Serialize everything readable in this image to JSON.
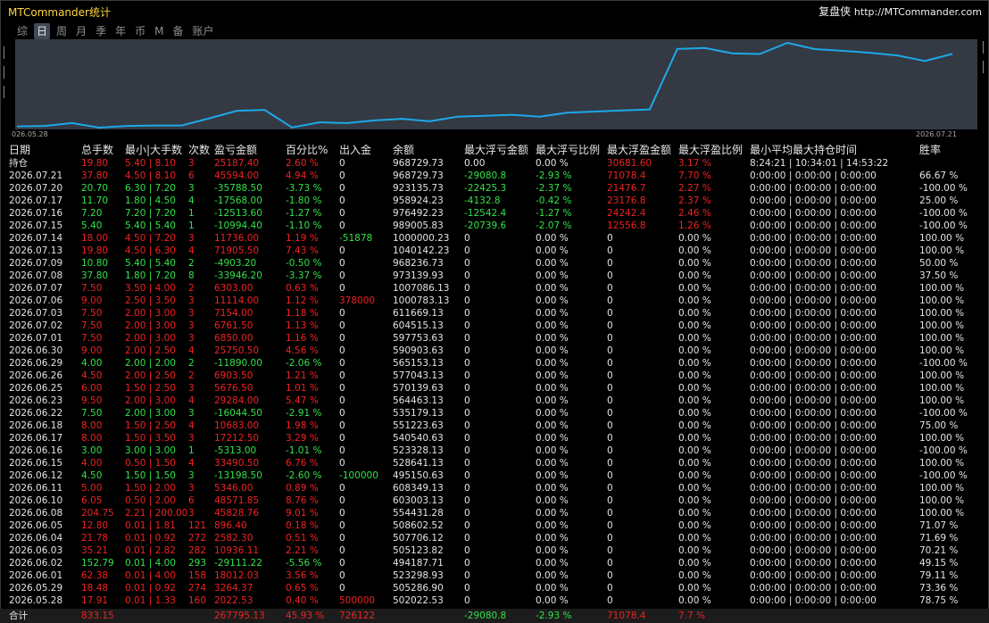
{
  "app_title": "MTCommander统计",
  "brand_name": "复盘侠",
  "brand_url": "http://MTCommander.com",
  "tabs": [
    "综",
    "日",
    "周",
    "月",
    "季",
    "年",
    "币",
    "M",
    "备",
    "账户"
  ],
  "active_tab": 1,
  "chart_data": {
    "type": "line",
    "x_start": "026.05.28",
    "x_end": "2026.07.21",
    "series_color": "#1ea8e8",
    "categories": [
      "2026.05.28",
      "2026.05.29",
      "2026.06.01",
      "2026.06.02",
      "2026.06.03",
      "2026.06.04",
      "2026.06.05",
      "2026.06.08",
      "2026.06.10",
      "2026.06.11",
      "2026.06.12",
      "2026.06.15",
      "2026.06.16",
      "2026.06.17",
      "2026.06.18",
      "2026.06.22",
      "2026.06.23",
      "2026.06.25",
      "2026.06.26",
      "2026.06.29",
      "2026.06.30",
      "2026.07.01",
      "2026.07.02",
      "2026.07.03",
      "2026.07.06",
      "2026.07.07",
      "2026.07.08",
      "2026.07.09",
      "2026.07.13",
      "2026.07.14",
      "2026.07.15",
      "2026.07.16",
      "2026.07.17",
      "2026.07.20",
      "2026.07.21"
    ],
    "values": [
      502022.53,
      505286.9,
      523298.93,
      494187.71,
      505123.82,
      507706.12,
      508602.52,
      554431.28,
      603003.13,
      608349.13,
      495150.63,
      528641.13,
      523328.13,
      540540.63,
      551223.63,
      535179.13,
      564463.13,
      570139.63,
      577043.13,
      565153.13,
      590903.63,
      597753.63,
      604515.13,
      611669.13,
      1000783.13,
      1007086.13,
      973139.93,
      968236.73,
      1040142.23,
      1000000.23,
      989005.83,
      976492.23,
      958924.23,
      923135.73,
      968729.73
    ]
  },
  "headers": [
    "日期",
    "总手数",
    "最小|大手数",
    "次数",
    "盈亏金额",
    "百分比%",
    "出入金",
    "余额",
    "最大浮亏金额",
    "最大浮亏比例",
    "最大浮盈金额",
    "最大浮盈比例",
    "最小平均最大持仓时间",
    "胜率"
  ],
  "position_row": {
    "label": "持仓",
    "lots": "19.80",
    "minmax": "5.40 | 8.10",
    "count": "3",
    "pl": "25187.40",
    "pct": "2.60 %",
    "flow": "0",
    "bal": "968729.73",
    "mfl": "0.00",
    "mflp": "0.00 %",
    "mfp": "30681.60",
    "mfpp": "3.17 %",
    "time": "8:24:21 | 10:34:01 | 14:53:22",
    "win": ""
  },
  "rows": [
    {
      "date": "2026.07.21",
      "lots": "37.80",
      "minmax": "4.50 | 8.10",
      "count": "6",
      "pl": "45594.00",
      "pct": "4.94 %",
      "flow": "0",
      "bal": "968729.73",
      "mfl": "-29080.8",
      "mflp": "-2.93 %",
      "mfp": "71078.4",
      "mfpp": "7.70 %",
      "time": "0:00:00 | 0:00:00 | 0:00:00",
      "win": "66.67 %",
      "c": "r"
    },
    {
      "date": "2026.07.20",
      "lots": "20.70",
      "minmax": "6.30 | 7.20",
      "count": "3",
      "pl": "-35788.50",
      "pct": "-3.73 %",
      "flow": "0",
      "bal": "923135.73",
      "mfl": "-22425.3",
      "mflp": "-2.37 %",
      "mfp": "21476.7",
      "mfpp": "2.27 %",
      "time": "0:00:00 | 0:00:00 | 0:00:00",
      "win": "-100.00 %",
      "c": "g"
    },
    {
      "date": "2026.07.17",
      "lots": "11.70",
      "minmax": "1.80 | 4.50",
      "count": "4",
      "pl": "-17568.00",
      "pct": "-1.80 %",
      "flow": "0",
      "bal": "958924.23",
      "mfl": "-4132.8",
      "mflp": "-0.42 %",
      "mfp": "23176.8",
      "mfpp": "2.37 %",
      "time": "0:00:00 | 0:00:00 | 0:00:00",
      "win": "25.00 %",
      "c": "g"
    },
    {
      "date": "2026.07.16",
      "lots": "7.20",
      "minmax": "7.20 | 7.20",
      "count": "1",
      "pl": "-12513.60",
      "pct": "-1.27 %",
      "flow": "0",
      "bal": "976492.23",
      "mfl": "-12542.4",
      "mflp": "-1.27 %",
      "mfp": "24242.4",
      "mfpp": "2.46 %",
      "time": "0:00:00 | 0:00:00 | 0:00:00",
      "win": "-100.00 %",
      "c": "g"
    },
    {
      "date": "2026.07.15",
      "lots": "5.40",
      "minmax": "5.40 | 5.40",
      "count": "1",
      "pl": "-10994.40",
      "pct": "-1.10 %",
      "flow": "0",
      "bal": "989005.83",
      "mfl": "-20739.6",
      "mflp": "-2.07 %",
      "mfp": "12556.8",
      "mfpp": "1.26 %",
      "time": "0:00:00 | 0:00:00 | 0:00:00",
      "win": "-100.00 %",
      "c": "g"
    },
    {
      "date": "2026.07.14",
      "lots": "18.00",
      "minmax": "4.50 | 7.20",
      "count": "3",
      "pl": "11736.00",
      "pct": "1.19 %",
      "flow": "-51878",
      "bal": "1000000.23",
      "mfl": "0",
      "mflp": "0.00 %",
      "mfp": "0",
      "mfpp": "0.00 %",
      "time": "0:00:00 | 0:00:00 | 0:00:00",
      "win": "100.00 %",
      "c": "r"
    },
    {
      "date": "2026.07.13",
      "lots": "19.80",
      "minmax": "4.50 | 6.30",
      "count": "4",
      "pl": "71905.50",
      "pct": "7.43 %",
      "flow": "0",
      "bal": "1040142.23",
      "mfl": "0",
      "mflp": "0.00 %",
      "mfp": "0",
      "mfpp": "0.00 %",
      "time": "0:00:00 | 0:00:00 | 0:00:00",
      "win": "100.00 %",
      "c": "r"
    },
    {
      "date": "2026.07.09",
      "lots": "10.80",
      "minmax": "5.40 | 5.40",
      "count": "2",
      "pl": "-4903.20",
      "pct": "-0.50 %",
      "flow": "0",
      "bal": "968236.73",
      "mfl": "0",
      "mflp": "0.00 %",
      "mfp": "0",
      "mfpp": "0.00 %",
      "time": "0:00:00 | 0:00:00 | 0:00:00",
      "win": "50.00 %",
      "c": "g"
    },
    {
      "date": "2026.07.08",
      "lots": "37.80",
      "minmax": "1.80 | 7.20",
      "count": "8",
      "pl": "-33946.20",
      "pct": "-3.37 %",
      "flow": "0",
      "bal": "973139.93",
      "mfl": "0",
      "mflp": "0.00 %",
      "mfp": "0",
      "mfpp": "0.00 %",
      "time": "0:00:00 | 0:00:00 | 0:00:00",
      "win": "37.50 %",
      "c": "g"
    },
    {
      "date": "2026.07.07",
      "lots": "7.50",
      "minmax": "3.50 | 4.00",
      "count": "2",
      "pl": "6303.00",
      "pct": "0.63 %",
      "flow": "0",
      "bal": "1007086.13",
      "mfl": "0",
      "mflp": "0.00 %",
      "mfp": "0",
      "mfpp": "0.00 %",
      "time": "0:00:00 | 0:00:00 | 0:00:00",
      "win": "100.00 %",
      "c": "r"
    },
    {
      "date": "2026.07.06",
      "lots": "9.00",
      "minmax": "2.50 | 3.50",
      "count": "3",
      "pl": "11114.00",
      "pct": "1.12 %",
      "flow": "378000",
      "bal": "1000783.13",
      "mfl": "0",
      "mflp": "0.00 %",
      "mfp": "0",
      "mfpp": "0.00 %",
      "time": "0:00:00 | 0:00:00 | 0:00:00",
      "win": "100.00 %",
      "c": "r"
    },
    {
      "date": "2026.07.03",
      "lots": "7.50",
      "minmax": "2.00 | 3.00",
      "count": "3",
      "pl": "7154.00",
      "pct": "1.18 %",
      "flow": "0",
      "bal": "611669.13",
      "mfl": "0",
      "mflp": "0.00 %",
      "mfp": "0",
      "mfpp": "0.00 %",
      "time": "0:00:00 | 0:00:00 | 0:00:00",
      "win": "100.00 %",
      "c": "r"
    },
    {
      "date": "2026.07.02",
      "lots": "7.50",
      "minmax": "2.00 | 3.00",
      "count": "3",
      "pl": "6761.50",
      "pct": "1.13 %",
      "flow": "0",
      "bal": "604515.13",
      "mfl": "0",
      "mflp": "0.00 %",
      "mfp": "0",
      "mfpp": "0.00 %",
      "time": "0:00:00 | 0:00:00 | 0:00:00",
      "win": "100.00 %",
      "c": "r"
    },
    {
      "date": "2026.07.01",
      "lots": "7.50",
      "minmax": "2.00 | 3.00",
      "count": "3",
      "pl": "6850.00",
      "pct": "1.16 %",
      "flow": "0",
      "bal": "597753.63",
      "mfl": "0",
      "mflp": "0.00 %",
      "mfp": "0",
      "mfpp": "0.00 %",
      "time": "0:00:00 | 0:00:00 | 0:00:00",
      "win": "100.00 %",
      "c": "r"
    },
    {
      "date": "2026.06.30",
      "lots": "9.00",
      "minmax": "2.00 | 2.50",
      "count": "4",
      "pl": "25750.50",
      "pct": "4.56 %",
      "flow": "0",
      "bal": "590903.63",
      "mfl": "0",
      "mflp": "0.00 %",
      "mfp": "0",
      "mfpp": "0.00 %",
      "time": "0:00:00 | 0:00:00 | 0:00:00",
      "win": "100.00 %",
      "c": "r"
    },
    {
      "date": "2026.06.29",
      "lots": "4.00",
      "minmax": "2.00 | 2.00",
      "count": "2",
      "pl": "-11890.00",
      "pct": "-2.06 %",
      "flow": "0",
      "bal": "565153.13",
      "mfl": "0",
      "mflp": "0.00 %",
      "mfp": "0",
      "mfpp": "0.00 %",
      "time": "0:00:00 | 0:00:00 | 0:00:00",
      "win": "-100.00 %",
      "c": "g"
    },
    {
      "date": "2026.06.26",
      "lots": "4.50",
      "minmax": "2.00 | 2.50",
      "count": "2",
      "pl": "6903.50",
      "pct": "1.21 %",
      "flow": "0",
      "bal": "577043.13",
      "mfl": "0",
      "mflp": "0.00 %",
      "mfp": "0",
      "mfpp": "0.00 %",
      "time": "0:00:00 | 0:00:00 | 0:00:00",
      "win": "100.00 %",
      "c": "r"
    },
    {
      "date": "2026.06.25",
      "lots": "6.00",
      "minmax": "1.50 | 2.50",
      "count": "3",
      "pl": "5676.50",
      "pct": "1.01 %",
      "flow": "0",
      "bal": "570139.63",
      "mfl": "0",
      "mflp": "0.00 %",
      "mfp": "0",
      "mfpp": "0.00 %",
      "time": "0:00:00 | 0:00:00 | 0:00:00",
      "win": "100.00 %",
      "c": "r"
    },
    {
      "date": "2026.06.23",
      "lots": "9.50",
      "minmax": "2.00 | 3.00",
      "count": "4",
      "pl": "29284.00",
      "pct": "5.47 %",
      "flow": "0",
      "bal": "564463.13",
      "mfl": "0",
      "mflp": "0.00 %",
      "mfp": "0",
      "mfpp": "0.00 %",
      "time": "0:00:00 | 0:00:00 | 0:00:00",
      "win": "100.00 %",
      "c": "r"
    },
    {
      "date": "2026.06.22",
      "lots": "7.50",
      "minmax": "2.00 | 3.00",
      "count": "3",
      "pl": "-16044.50",
      "pct": "-2.91 %",
      "flow": "0",
      "bal": "535179.13",
      "mfl": "0",
      "mflp": "0.00 %",
      "mfp": "0",
      "mfpp": "0.00 %",
      "time": "0:00:00 | 0:00:00 | 0:00:00",
      "win": "-100.00 %",
      "c": "g"
    },
    {
      "date": "2026.06.18",
      "lots": "8.00",
      "minmax": "1.50 | 2.50",
      "count": "4",
      "pl": "10683.00",
      "pct": "1.98 %",
      "flow": "0",
      "bal": "551223.63",
      "mfl": "0",
      "mflp": "0.00 %",
      "mfp": "0",
      "mfpp": "0.00 %",
      "time": "0:00:00 | 0:00:00 | 0:00:00",
      "win": "75.00 %",
      "c": "r"
    },
    {
      "date": "2026.06.17",
      "lots": "8.00",
      "minmax": "1.50 | 3.50",
      "count": "3",
      "pl": "17212.50",
      "pct": "3.29 %",
      "flow": "0",
      "bal": "540540.63",
      "mfl": "0",
      "mflp": "0.00 %",
      "mfp": "0",
      "mfpp": "0.00 %",
      "time": "0:00:00 | 0:00:00 | 0:00:00",
      "win": "100.00 %",
      "c": "r"
    },
    {
      "date": "2026.06.16",
      "lots": "3.00",
      "minmax": "3.00 | 3.00",
      "count": "1",
      "pl": "-5313.00",
      "pct": "-1.01 %",
      "flow": "0",
      "bal": "523328.13",
      "mfl": "0",
      "mflp": "0.00 %",
      "mfp": "0",
      "mfpp": "0.00 %",
      "time": "0:00:00 | 0:00:00 | 0:00:00",
      "win": "-100.00 %",
      "c": "g"
    },
    {
      "date": "2026.06.15",
      "lots": "4.00",
      "minmax": "0.50 | 1.50",
      "count": "4",
      "pl": "33490.50",
      "pct": "6.76 %",
      "flow": "0",
      "bal": "528641.13",
      "mfl": "0",
      "mflp": "0.00 %",
      "mfp": "0",
      "mfpp": "0.00 %",
      "time": "0:00:00 | 0:00:00 | 0:00:00",
      "win": "100.00 %",
      "c": "r"
    },
    {
      "date": "2026.06.12",
      "lots": "4.50",
      "minmax": "1.50 | 1.50",
      "count": "3",
      "pl": "-13198.50",
      "pct": "-2.60 %",
      "flow": "-100000",
      "bal": "495150.63",
      "mfl": "0",
      "mflp": "0.00 %",
      "mfp": "0",
      "mfpp": "0.00 %",
      "time": "0:00:00 | 0:00:00 | 0:00:00",
      "win": "-100.00 %",
      "c": "g"
    },
    {
      "date": "2026.06.11",
      "lots": "5.00",
      "minmax": "1.50 | 2.00",
      "count": "3",
      "pl": "5346.00",
      "pct": "0.89 %",
      "flow": "0",
      "bal": "608349.13",
      "mfl": "0",
      "mflp": "0.00 %",
      "mfp": "0",
      "mfpp": "0.00 %",
      "time": "0:00:00 | 0:00:00 | 0:00:00",
      "win": "100.00 %",
      "c": "r"
    },
    {
      "date": "2026.06.10",
      "lots": "6.05",
      "minmax": "0.50 | 2.00",
      "count": "6",
      "pl": "48571.85",
      "pct": "8.76 %",
      "flow": "0",
      "bal": "603003.13",
      "mfl": "0",
      "mflp": "0.00 %",
      "mfp": "0",
      "mfpp": "0.00 %",
      "time": "0:00:00 | 0:00:00 | 0:00:00",
      "win": "100.00 %",
      "c": "r"
    },
    {
      "date": "2026.06.08",
      "lots": "204.75",
      "minmax": "2.21 | 200.00",
      "count": "3",
      "pl": "45828.76",
      "pct": "9.01 %",
      "flow": "0",
      "bal": "554431.28",
      "mfl": "0",
      "mflp": "0.00 %",
      "mfp": "0",
      "mfpp": "0.00 %",
      "time": "0:00:00 | 0:00:00 | 0:00:00",
      "win": "100.00 %",
      "c": "r"
    },
    {
      "date": "2026.06.05",
      "lots": "12.80",
      "minmax": "0.01 | 1.81",
      "count": "121",
      "pl": "896.40",
      "pct": "0.18 %",
      "flow": "0",
      "bal": "508602.52",
      "mfl": "0",
      "mflp": "0.00 %",
      "mfp": "0",
      "mfpp": "0.00 %",
      "time": "0:00:00 | 0:00:00 | 0:00:00",
      "win": "71.07 %",
      "c": "r"
    },
    {
      "date": "2026.06.04",
      "lots": "21.78",
      "minmax": "0.01 | 0.92",
      "count": "272",
      "pl": "2582.30",
      "pct": "0.51 %",
      "flow": "0",
      "bal": "507706.12",
      "mfl": "0",
      "mflp": "0.00 %",
      "mfp": "0",
      "mfpp": "0.00 %",
      "time": "0:00:00 | 0:00:00 | 0:00:00",
      "win": "71.69 %",
      "c": "r"
    },
    {
      "date": "2026.06.03",
      "lots": "35.21",
      "minmax": "0.01 | 2.82",
      "count": "282",
      "pl": "10936.11",
      "pct": "2.21 %",
      "flow": "0",
      "bal": "505123.82",
      "mfl": "0",
      "mflp": "0.00 %",
      "mfp": "0",
      "mfpp": "0.00 %",
      "time": "0:00:00 | 0:00:00 | 0:00:00",
      "win": "70.21 %",
      "c": "r"
    },
    {
      "date": "2026.06.02",
      "lots": "152.79",
      "minmax": "0.01 | 4.00",
      "count": "293",
      "pl": "-29111.22",
      "pct": "-5.56 %",
      "flow": "0",
      "bal": "494187.71",
      "mfl": "0",
      "mflp": "0.00 %",
      "mfp": "0",
      "mfpp": "0.00 %",
      "time": "0:00:00 | 0:00:00 | 0:00:00",
      "win": "49.15 %",
      "c": "g"
    },
    {
      "date": "2026.06.01",
      "lots": "62.38",
      "minmax": "0.01 | 4.00",
      "count": "158",
      "pl": "18012.03",
      "pct": "3.56 %",
      "flow": "0",
      "bal": "523298.93",
      "mfl": "0",
      "mflp": "0.00 %",
      "mfp": "0",
      "mfpp": "0.00 %",
      "time": "0:00:00 | 0:00:00 | 0:00:00",
      "win": "79.11 %",
      "c": "r"
    },
    {
      "date": "2026.05.29",
      "lots": "18.48",
      "minmax": "0.01 | 0.92",
      "count": "274",
      "pl": "3264.37",
      "pct": "0.65 %",
      "flow": "0",
      "bal": "505286.90",
      "mfl": "0",
      "mflp": "0.00 %",
      "mfp": "0",
      "mfpp": "0.00 %",
      "time": "0:00:00 | 0:00:00 | 0:00:00",
      "win": "73.36 %",
      "c": "r"
    },
    {
      "date": "2026.05.28",
      "lots": "17.91",
      "minmax": "0.01 | 1.33",
      "count": "160",
      "pl": "2022.53",
      "pct": "0.40 %",
      "flow": "500000",
      "bal": "502022.53",
      "mfl": "0",
      "mflp": "0.00 %",
      "mfp": "0",
      "mfpp": "0.00 %",
      "time": "0:00:00 | 0:00:00 | 0:00:00",
      "win": "78.75 %",
      "c": "r"
    }
  ],
  "total_row": {
    "label": "合计",
    "lots": "833.15",
    "pl": "267795.13",
    "pct": "45.93 %",
    "flow": "726122",
    "mfl": "-29080.8",
    "mflp": "-2.93 %",
    "mfp": "71078.4",
    "mfpp": "7.7 %"
  },
  "colors": {
    "loss": "#34e04a",
    "gain": "#ee2222",
    "neutral": "#e4e4e4",
    "title": "#ffd83a",
    "chart_bg": "#333a43",
    "line": "#1ea8e8"
  }
}
